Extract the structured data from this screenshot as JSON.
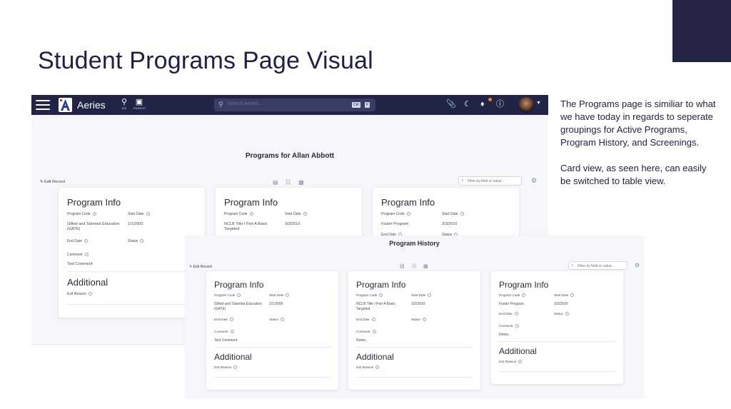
{
  "slide": {
    "title": "Student Programs Page Visual",
    "accent_color": "#232448",
    "notes": [
      "The Programs page is similiar to what we have today in regards to seperate groupings for Active Programs, Program History, and Screenings.",
      "Card view, as seen here, can easily be switched to table view."
    ]
  },
  "app": {
    "brand": "Aeries",
    "logo_letter": "A",
    "nav": [
      {
        "icon": "location-pin-icon",
        "label": "SIS"
      },
      {
        "icon": "id-badge-icon",
        "label": "PARENT"
      }
    ],
    "search": {
      "placeholder": "Search Aeries...",
      "shortcut": [
        "Ctrl",
        "K"
      ]
    },
    "topbar_colors": {
      "bar": "#222447",
      "notification_dot": "#f07a3a"
    },
    "notification_count": "1"
  },
  "programs_page": {
    "title": "Programs for Allan Abbott",
    "edit_label": "Edit Record",
    "filter_placeholder": "Filter by field or value...",
    "cards": [
      {
        "heading": "Program Info",
        "program_code_label": "Program Code",
        "program_code": "Gifted and Talented Education (GATE)",
        "start_date_label": "Start Date",
        "start_date": "1/1/2000",
        "end_date_label": "End Date",
        "status_label": "Status",
        "comment_label": "Comment",
        "comment": "Test Comment",
        "additional_heading": "Additional",
        "exit_reason_label": "Exit Reason"
      },
      {
        "heading": "Program Info",
        "program_code_label": "Program Code",
        "program_code": "NCLB Title I Part A Basic Targeted",
        "start_date_label": "Start Date",
        "start_date": "3/3/2010"
      },
      {
        "heading": "Program Info",
        "program_code_label": "Program Code",
        "program_code": "Foster Program",
        "start_date_label": "Start Date",
        "start_date": "3/3/2010",
        "end_date_label": "End Date",
        "status_label": "Status"
      }
    ]
  },
  "history_page": {
    "title": "Program History",
    "edit_label": "Edit Record",
    "filter_placeholder": "Filter by field or value...",
    "cards": [
      {
        "heading": "Program Info",
        "program_code_label": "Program Code",
        "program_code": "Gifted and Talented Education (GATE)",
        "start_date_label": "Start Date",
        "start_date": "1/1/2000",
        "end_date_label": "End Date",
        "status_label": "Status",
        "comment_label": "Comment",
        "comment": "Test Comment",
        "additional_heading": "Additional",
        "exit_reason_label": "Exit Reason"
      },
      {
        "heading": "Program Info",
        "program_code_label": "Program Code",
        "program_code": "NCLB Title I Part A Basic Targeted",
        "start_date_label": "Start Date",
        "start_date": "3/3/2010",
        "end_date_label": "End Date",
        "status_label": "Status",
        "comment_label": "Comment",
        "comment": "Notes..",
        "additional_heading": "Additional",
        "exit_reason_label": "Exit Reason"
      },
      {
        "heading": "Program Info",
        "program_code_label": "Program Code",
        "program_code": "Foster Program",
        "start_date_label": "Start Date",
        "start_date": "3/3/2010",
        "end_date_label": "End Date",
        "status_label": "Status",
        "comment_label": "Comment",
        "comment": "Notes..",
        "additional_heading": "Additional",
        "exit_reason_label": "Exit Reason"
      }
    ]
  }
}
